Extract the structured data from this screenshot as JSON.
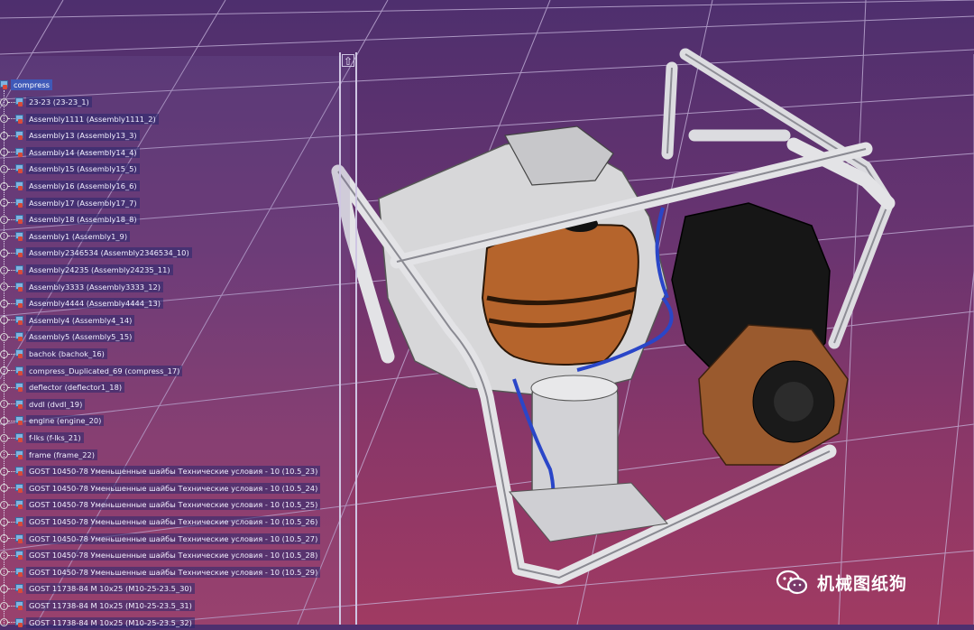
{
  "viewport": {
    "background_top": "#4e2f6e",
    "background_bottom": "#a03a62",
    "grid_color": "#c9b8de"
  },
  "tree": {
    "root": "compress",
    "items": [
      {
        "label": "23-23 (23-23_1)"
      },
      {
        "label": "Assembly1111 (Assembly1111_2)"
      },
      {
        "label": "Assembly13 (Assembly13_3)"
      },
      {
        "label": "Assembly14 (Assembly14_4)"
      },
      {
        "label": "Assembly15 (Assembly15_5)"
      },
      {
        "label": "Assembly16 (Assembly16_6)"
      },
      {
        "label": "Assembly17 (Assembly17_7)"
      },
      {
        "label": "Assembly18 (Assembly18_8)"
      },
      {
        "label": "Assembly1 (Assembly1_9)"
      },
      {
        "label": "Assembly2346534 (Assembly2346534_10)"
      },
      {
        "label": "Assembly24235 (Assembly24235_11)"
      },
      {
        "label": "Assembly3333 (Assembly3333_12)"
      },
      {
        "label": "Assembly4444 (Assembly4444_13)"
      },
      {
        "label": "Assembly4 (Assembly4_14)"
      },
      {
        "label": "Assembly5 (Assembly5_15)"
      },
      {
        "label": "bachok (bachok_16)"
      },
      {
        "label": "compress_Duplicated_69 (compress_17)"
      },
      {
        "label": "deflector (deflector1_18)"
      },
      {
        "label": "dvdl (dvdl_19)"
      },
      {
        "label": "engine (engine_20)"
      },
      {
        "label": "f-lks (f-lks_21)"
      },
      {
        "label": "frame (frame_22)"
      },
      {
        "label": "GOST 10450-78 Уменьшенные шайбы Технические условия - 10 (10.5_23)"
      },
      {
        "label": "GOST 10450-78 Уменьшенные шайбы Технические условия - 10 (10.5_24)"
      },
      {
        "label": "GOST 10450-78 Уменьшенные шайбы Технические условия - 10 (10.5_25)"
      },
      {
        "label": "GOST 10450-78 Уменьшенные шайбы Технические условия - 10 (10.5_26)"
      },
      {
        "label": "GOST 10450-78 Уменьшенные шайбы Технические условия - 10 (10.5_27)"
      },
      {
        "label": "GOST 10450-78 Уменьшенные шайбы Технические условия - 10 (10.5_28)"
      },
      {
        "label": "GOST 10450-78 Уменьшенные шайбы Технические условия - 10 (10.5_29)"
      },
      {
        "label": "GOST 11738-84 M 10x25 (M10-25-23.5_30)"
      },
      {
        "label": "GOST 11738-84 M 10x25 (M10-25-23.5_31)"
      },
      {
        "label": "GOST 11738-84 M 10x25 (M10-25-23.5_32)"
      }
    ]
  },
  "watermark": {
    "text": "机械图纸狗",
    "icon": "wechat-icon"
  },
  "model": {
    "frame_color": "#d9d9dc",
    "tank_color": "#b5642c",
    "engine_color": "#141414",
    "shroud_color": "#9a5a2e"
  }
}
